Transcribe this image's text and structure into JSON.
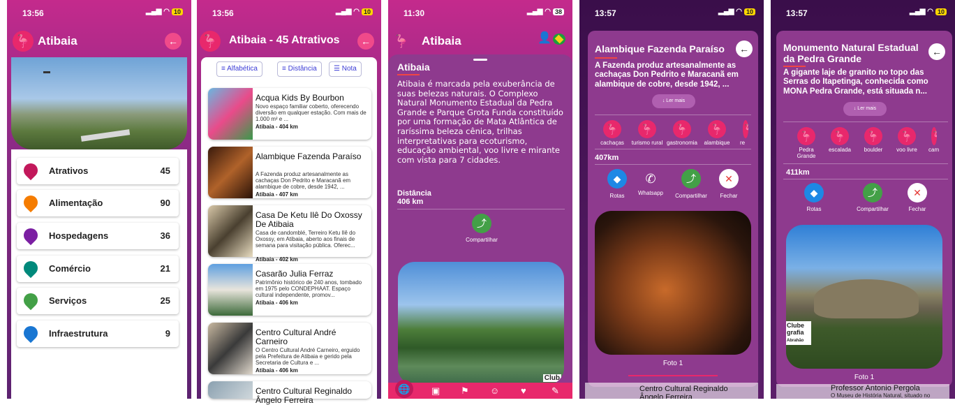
{
  "phone1": {
    "status": {
      "time": "13:56",
      "battery": "10"
    },
    "title": "Atibaia",
    "categories": [
      {
        "label": "Atrativos",
        "count": "45",
        "color": "#c2185b",
        "icon": "star-icon"
      },
      {
        "label": "Alimentação",
        "count": "90",
        "color": "#f57c00",
        "icon": "restaurant-icon"
      },
      {
        "label": "Hospedagens",
        "count": "36",
        "color": "#7b1fa2",
        "icon": "bed-icon"
      },
      {
        "label": "Comércio",
        "count": "21",
        "color": "#00897b",
        "icon": "cart-icon"
      },
      {
        "label": "Serviços",
        "count": "25",
        "color": "#43a047",
        "icon": "headset-icon"
      },
      {
        "label": "Infraestrutura",
        "count": "9",
        "color": "#1976d2",
        "icon": "building-icon"
      }
    ]
  },
  "phone2": {
    "status": {
      "time": "13:56",
      "battery": "10"
    },
    "title": "Atibaia - 45  Atrativos",
    "sort": {
      "alpha": "Alfabética",
      "dist": "Distância",
      "rating": "Nota"
    },
    "items": [
      {
        "name": "Acqua Kids By Bourbon",
        "desc": "Novo espaço familiar coberto, oferecendo diversão em qualquer estação. Com mais de 1.000 m² e ...",
        "km": "Atibaia - 404 km"
      },
      {
        "name": "Alambique Fazenda Paraíso",
        "desc": "A Fazenda produz artesanalmente as cachaças Don Pedrito e Maracanã em alambique de cobre, desde 1942, ...",
        "km": "Atibaia - 407 km"
      },
      {
        "name": "Casa De Ketu Ilê Do Oxossy De Atibaia",
        "desc": "Casa de candomblé, Terreiro Ketu Ilê do Oxossy, em Atibaia, aberto aos finais de semana para visitação pública. Oferec...",
        "km": "Atibaia - 402 km"
      },
      {
        "name": "Casarão Julia Ferraz",
        "desc": "Patrimônio histórico de 240 anos, tombado em 1975 pelo CONDEPHAAT. Espaço cultural independente, promov...",
        "km": "Atibaia - 406 km"
      },
      {
        "name": "Centro Cultural André Carneiro",
        "desc": "O Centro Cultural André Carneiro, erguido pela Prefeitura de Atibaia e gerido pela Secretaria de Cultura e ...",
        "km": "Atibaia - 406 km"
      },
      {
        "name": "Centro Cultural Reginaldo Ângelo Ferreira",
        "desc": "",
        "km": ""
      }
    ]
  },
  "phone3": {
    "status": {
      "time": "11:30",
      "battery": "38"
    },
    "title": "Atibaia",
    "heading": "Atibaia",
    "body": "Atibaia é marcada pela exuberância de suas belezas naturais. O Complexo Natural Monumento Estadual da Pedra Grande e Parque Grota Funda constituído por uma formação de Mata Atlântica de raríssima beleza cênica, trilhas interpretativas para ecoturismo, educação ambiental, voo livre e mirante com vista para 7 cidades.",
    "dist_label": "Distância",
    "dist_value": "406 km",
    "share": "Compartilhar",
    "watermark": "Club"
  },
  "phone4": {
    "status": {
      "time": "13:57",
      "battery": "10"
    },
    "title": "Alambique Fazenda Paraíso",
    "desc": "A Fazenda produz artesanalmente as cachaças Don Pedrito e Maracanã em alambique de cobre, desde 1942, ...",
    "more": "Ler mais",
    "tags": [
      "cachaças",
      "turismo rural",
      "gastronomia",
      "alambique",
      "re"
    ],
    "km": "407km",
    "actions": {
      "routes": "Rotas",
      "whatsapp": "Whatsapp",
      "share": "Compartilhar",
      "close": "Fechar"
    },
    "photo": "Foto 1",
    "bg_item": "Centro Cultural Reginaldo",
    "bg_item2": "Ângelo Ferreira"
  },
  "phone5": {
    "status": {
      "time": "13:57",
      "battery": "10"
    },
    "title": "Monumento Natural Estadual da Pedra Grande",
    "desc": "A gigante laje de granito no topo das Serras do Itapetinga, conhecida como MONA Pedra Grande, está situada n...",
    "more": "Ler mais",
    "tags": [
      "Pedra Grande",
      "escalada",
      "boulder",
      "voo livre",
      "cam"
    ],
    "km": "411km",
    "actions": {
      "routes": "Rotas",
      "share": "Compartilhar",
      "close": "Fechar"
    },
    "photo": "Foto 1",
    "watermark": "Clube",
    "watermark2": "grafia",
    "watermark3": "Abrahão",
    "bg_item": "Professor Antonio Pergola",
    "bg_item_desc": "O Museu de História Natural, situado no"
  }
}
